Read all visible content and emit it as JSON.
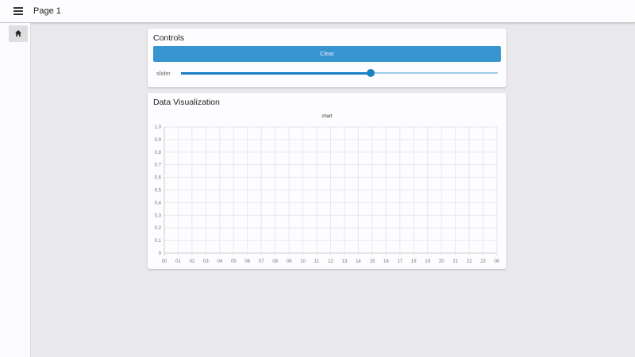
{
  "header": {
    "title": "Page 1",
    "menu_icon": "menu-icon"
  },
  "sidebar": {
    "items": [
      {
        "icon": "home-icon"
      }
    ]
  },
  "controls": {
    "title": "Controls",
    "clear_label": "Clear",
    "slider_label": "slider",
    "slider_value": 0.6
  },
  "viz": {
    "title": "Data Visualization"
  },
  "chart_data": {
    "type": "line",
    "title": "chart",
    "series": [],
    "ylim": [
      0,
      1.0
    ],
    "yticks": [
      "0",
      "0.1",
      "0.2",
      "0.3",
      "0.4",
      "0.5",
      "0.6",
      "0.7",
      "0.8",
      "0.9",
      "1.0"
    ],
    "xticks": [
      "00",
      "01",
      "02",
      "03",
      "04",
      "05",
      "06",
      "07",
      "08",
      "09",
      "10",
      "11",
      "12",
      "13",
      "14",
      "15",
      "16",
      "17",
      "18",
      "19",
      "20",
      "21",
      "22",
      "23",
      "00"
    ],
    "grid": true
  }
}
